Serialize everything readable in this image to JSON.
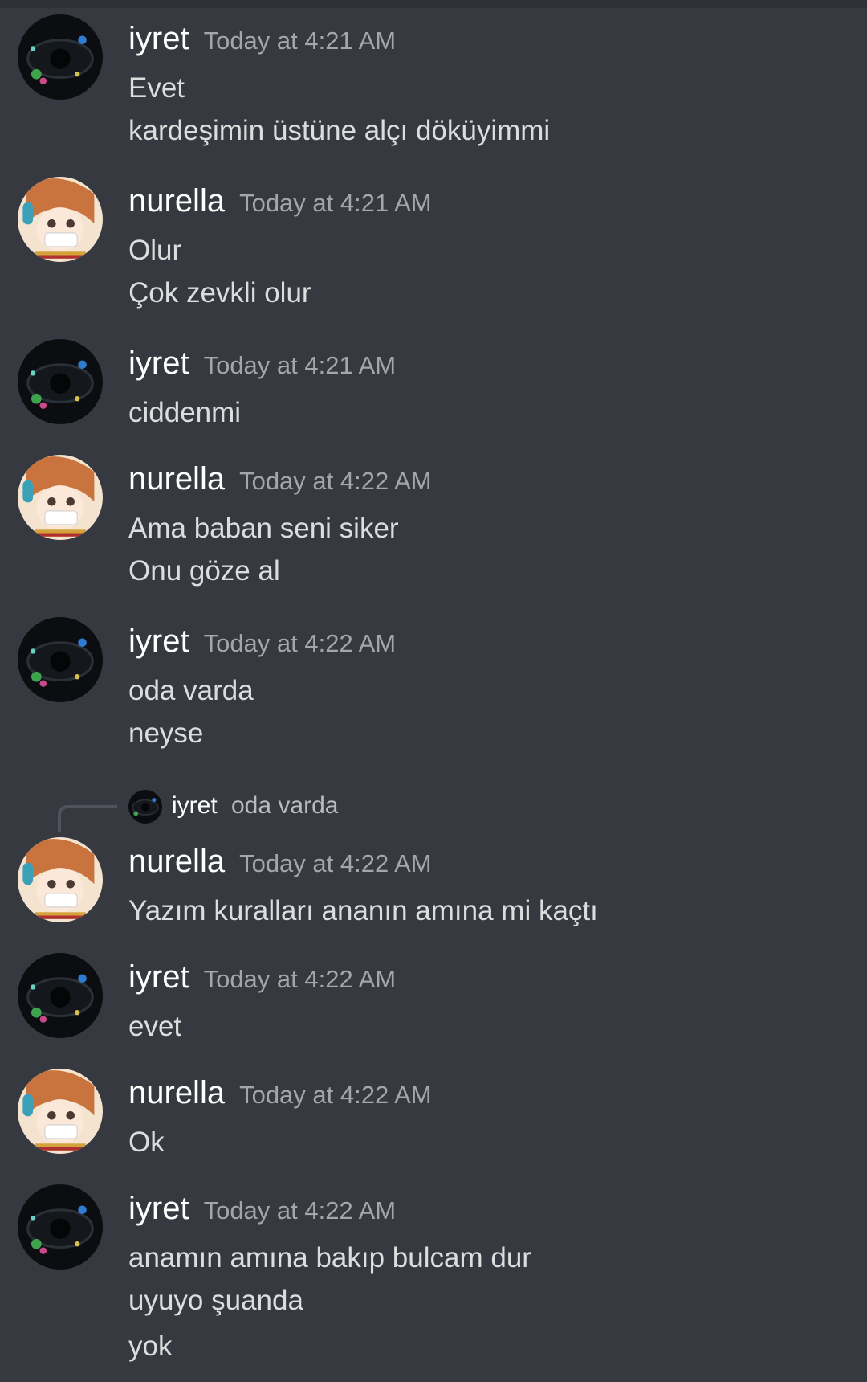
{
  "messages": [
    {
      "author": "iyret",
      "time": "Today at 4:21 AM",
      "lines": [
        "Evet",
        "kardeşimin üstüne alçı döküyimmi"
      ]
    },
    {
      "author": "nurella",
      "time": "Today at 4:21 AM",
      "lines": [
        "Olur",
        "Çok zevkli olur"
      ]
    },
    {
      "author": "iyret",
      "time": "Today at 4:21 AM",
      "lines": [
        "ciddenmi"
      ]
    },
    {
      "author": "nurella",
      "time": "Today at 4:22 AM",
      "lines": [
        "Ama baban seni siker",
        "Onu göze al"
      ]
    },
    {
      "author": "iyret",
      "time": "Today at 4:22 AM",
      "lines": [
        "oda varda",
        "neyse"
      ]
    },
    {
      "author": "nurella",
      "time": "Today at 4:22 AM",
      "lines": [
        "Yazım kuralları ananın amına mi kaçtı"
      ],
      "reply": {
        "author": "iyret",
        "text": "oda varda"
      }
    },
    {
      "author": "iyret",
      "time": "Today at 4:22 AM",
      "lines": [
        "evet"
      ]
    },
    {
      "author": "nurella",
      "time": "Today at 4:22 AM",
      "lines": [
        "Ok"
      ]
    },
    {
      "author": "iyret",
      "time": "Today at 4:22 AM",
      "lines": [
        "anamın amına bakıp bulcam dur",
        "uyuyo şuanda",
        "yok"
      ]
    }
  ],
  "colors": {
    "background": "#36393f",
    "username": "#ffffff",
    "timestamp": "#a3a6aa",
    "text": "#dcddde"
  }
}
